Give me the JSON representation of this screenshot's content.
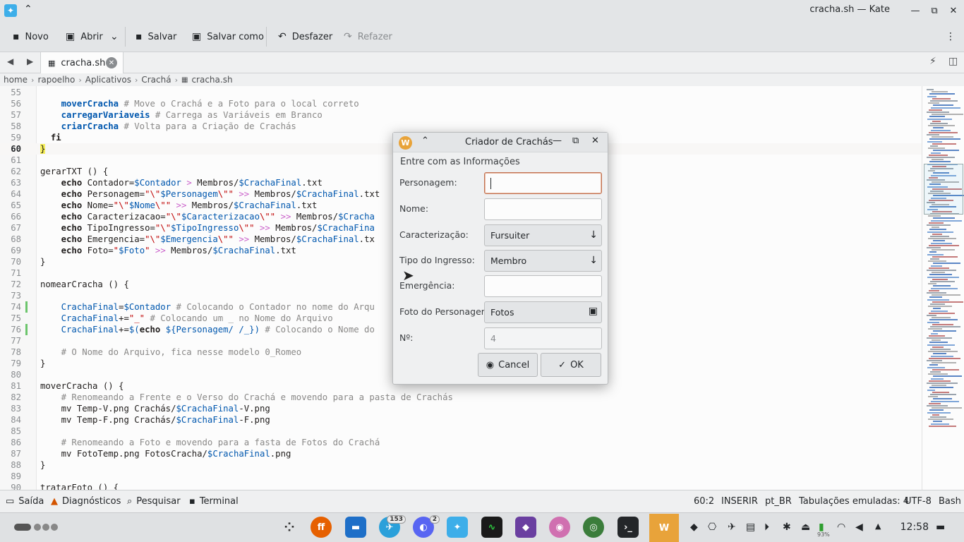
{
  "window": {
    "title": "cracha.sh — Kate",
    "minimize": "—",
    "maximize": "⧉",
    "close": "✕"
  },
  "toolbar": {
    "new": "Novo",
    "open": "Abrir",
    "save": "Salvar",
    "save_as": "Salvar como",
    "undo": "Desfazer",
    "redo": "Refazer"
  },
  "tab": {
    "label": "cracha.sh"
  },
  "breadcrumb": [
    "home",
    "rapoelho",
    "Aplicativos",
    "Crachá",
    "cracha.sh"
  ],
  "editor": {
    "lines": [
      {
        "n": "55",
        "t": ""
      },
      {
        "n": "56",
        "t": ""
      },
      {
        "n": "57",
        "t": ""
      },
      {
        "n": "58",
        "t": ""
      },
      {
        "n": "59",
        "t": "  fi"
      },
      {
        "n": "60",
        "t": ""
      },
      {
        "n": "61",
        "t": ""
      },
      {
        "n": "62",
        "t": ""
      },
      {
        "n": "63",
        "t": ""
      },
      {
        "n": "64",
        "t": ""
      },
      {
        "n": "65",
        "t": ""
      },
      {
        "n": "66",
        "t": ""
      },
      {
        "n": "67",
        "t": ""
      },
      {
        "n": "68",
        "t": ""
      },
      {
        "n": "69",
        "t": ""
      },
      {
        "n": "70",
        "t": "}"
      },
      {
        "n": "71",
        "t": ""
      },
      {
        "n": "72",
        "t": "nomearCracha () {"
      },
      {
        "n": "73",
        "t": ""
      },
      {
        "n": "74",
        "t": ""
      },
      {
        "n": "75",
        "t": ""
      },
      {
        "n": "76",
        "t": ""
      },
      {
        "n": "77",
        "t": ""
      },
      {
        "n": "78",
        "t": ""
      },
      {
        "n": "79",
        "t": "}"
      },
      {
        "n": "80",
        "t": ""
      },
      {
        "n": "81",
        "t": "moverCracha () {"
      },
      {
        "n": "82",
        "t": ""
      },
      {
        "n": "83",
        "t": ""
      },
      {
        "n": "84",
        "t": ""
      },
      {
        "n": "85",
        "t": ""
      },
      {
        "n": "86",
        "t": ""
      },
      {
        "n": "87",
        "t": ""
      },
      {
        "n": "88",
        "t": "}"
      },
      {
        "n": "89",
        "t": ""
      },
      {
        "n": "90",
        "t": "tratarFoto () {"
      }
    ]
  },
  "status": {
    "output": "Saída",
    "diagnostics": "Diagnósticos",
    "search": "Pesquisar",
    "terminal": "Terminal",
    "position": "60:2",
    "mode": "INSERIR",
    "lang": "pt_BR",
    "indent": "Tabulações emuladas: 4",
    "encoding": "UTF-8",
    "syntax": "Bash"
  },
  "dialog": {
    "title": "Criador de Crachás",
    "subtitle": "Entre com as Informações",
    "fields": {
      "personagem": "Personagem:",
      "nome": "Nome:",
      "caracterizacao": "Caracterização:",
      "tipo": "Tipo do Ingresso:",
      "emergencia": "Emergência:",
      "foto": "Foto do Personagem",
      "numero": "Nº:"
    },
    "values": {
      "caracterizacao": "Fursuiter",
      "tipo": "Membro",
      "foto": "Fotos",
      "numero": "4"
    },
    "cancel": "Cancel",
    "ok": "OK"
  },
  "taskbar": {
    "clock": "12:58",
    "badge_telegram": "153",
    "badge_discord": "2",
    "battery": "93%"
  }
}
